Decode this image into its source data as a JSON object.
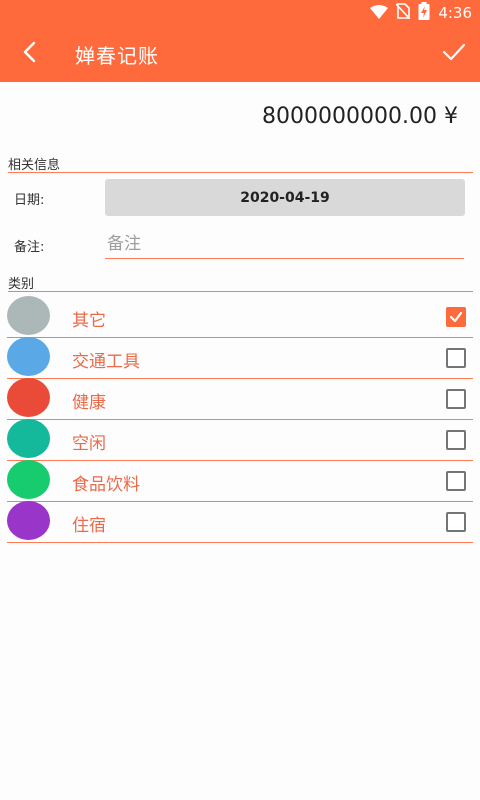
{
  "status": {
    "time": "4:36"
  },
  "appbar": {
    "title": "婵春记账"
  },
  "amount": "8000000000.00 ¥",
  "section_info": "相关信息",
  "date_label": "日期:",
  "date_value": "2020-04-19",
  "note_label": "备注:",
  "note_placeholder": "备注",
  "section_category": "类别",
  "categories": [
    {
      "label": "其它",
      "color": "#acb8b8",
      "checked": true
    },
    {
      "label": "交通工具",
      "color": "#5aa9e6",
      "checked": false
    },
    {
      "label": "健康",
      "color": "#ea4b39",
      "checked": false
    },
    {
      "label": "空闲",
      "color": "#14b89a",
      "checked": false
    },
    {
      "label": "食品饮料",
      "color": "#17cc6e",
      "checked": false
    },
    {
      "label": "住宿",
      "color": "#9a35c9",
      "checked": false
    }
  ],
  "colors": {
    "accent": "#ff6a3d",
    "divider": "#ff7a55",
    "category_text": "#ea6a4a"
  }
}
